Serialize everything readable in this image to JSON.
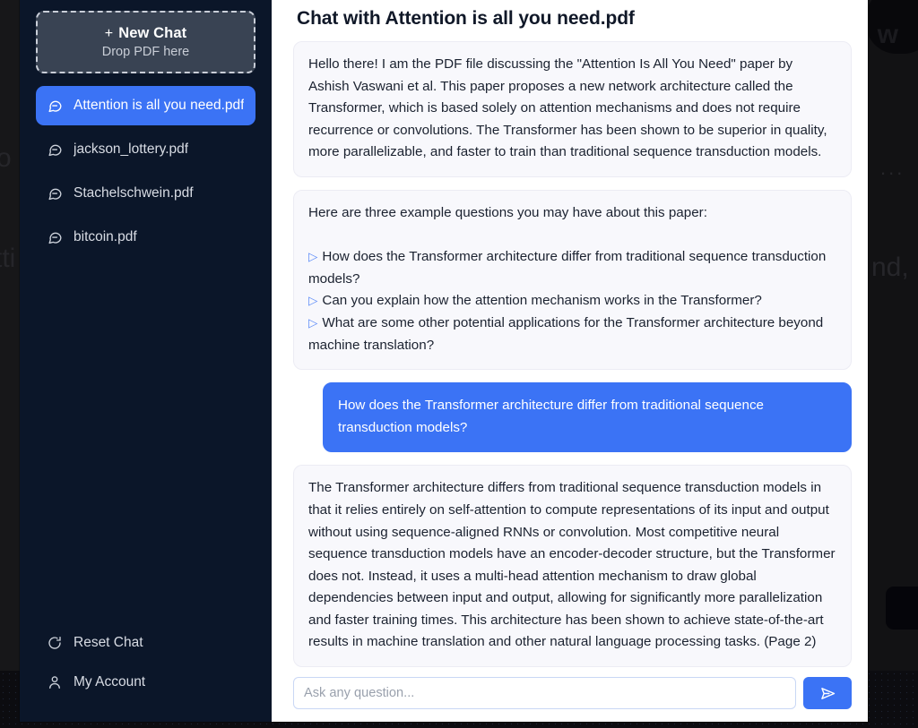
{
  "backdrop": {
    "ghost_fragments": [
      "tti",
      "o",
      "nd,",
      "w",
      "..."
    ]
  },
  "sidebar": {
    "new_chat": {
      "title": "New Chat",
      "plus": "+",
      "subtitle": "Drop PDF here"
    },
    "chats": [
      {
        "label": "Attention is all you need.pdf",
        "icon": "chat-bubble-icon",
        "active": true
      },
      {
        "label": "jackson_lottery.pdf",
        "icon": "chat-bubble-icon",
        "active": false
      },
      {
        "label": "Stachelschwein.pdf",
        "icon": "chat-bubble-icon",
        "active": false
      },
      {
        "label": "bitcoin.pdf",
        "icon": "chat-bubble-icon",
        "active": false
      }
    ],
    "footer": [
      {
        "label": "Reset Chat",
        "icon": "reset-arrow-icon"
      },
      {
        "label": "My Account",
        "icon": "person-icon"
      }
    ]
  },
  "header": {
    "title": "Chat with Attention is all you need.pdf"
  },
  "messages": {
    "intro_paragraph": "Hello there! I am the PDF file discussing the \"Attention Is All You Need\" paper by Ashish Vaswani et al. This paper proposes a new network architecture called the Transformer, which is based solely on attention mechanisms and does not require recurrence or convolutions. The Transformer has been shown to be superior in quality, more parallelizable, and faster to train than traditional sequence transduction models.",
    "questions_lead": "Here are three example questions you may have about this paper:",
    "bullet_glyph": "▷",
    "example_questions": [
      "How does the Transformer architecture differ from traditional sequence transduction models?",
      "Can you explain how the attention mechanism works in the Transformer?",
      "What are some other potential applications for the Transformer architecture beyond machine translation?"
    ],
    "user_question": "How does the Transformer architecture differ from traditional sequence transduction models?",
    "answer": "The Transformer architecture differs from traditional sequence transduction models in that it relies entirely on self-attention to compute representations of its input and output without using sequence-aligned RNNs or convolution. Most competitive neural sequence transduction models have an encoder-decoder structure, but the Transformer does not. Instead, it uses a multi-head attention mechanism to draw global dependencies between input and output, allowing for significantly more parallelization and faster training times. This architecture has been shown to achieve state-of-the-art results in machine translation and other natural language processing tasks. (Page 2)"
  },
  "composer": {
    "placeholder": "Ask any question...",
    "value": "",
    "send_icon": "send-paper-plane-icon"
  },
  "colors": {
    "accent_blue": "#3b73f5",
    "sidebar_bg": "#0b1629",
    "bot_bubble_bg": "#f8f8fc",
    "dropzone_bg": "#394353"
  }
}
